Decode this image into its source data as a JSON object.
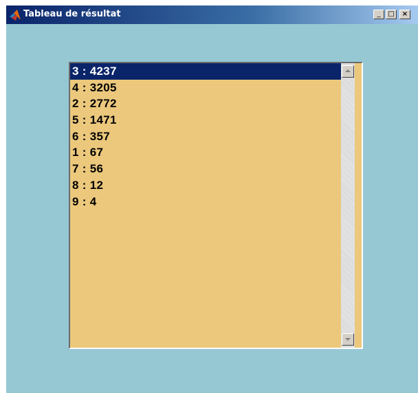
{
  "window": {
    "title": "Tableau de résultat",
    "controls": {
      "minimize": "_",
      "maximize": "□",
      "close": "×"
    },
    "icon": "matlab-icon"
  },
  "list": {
    "selected_index": 0,
    "items": [
      "3 : 4237",
      "4 : 3205",
      "2 : 2772",
      "5 : 1471",
      "6 : 357",
      "1 : 67",
      "7 : 56",
      "8 : 12",
      "9 : 4"
    ]
  },
  "colors": {
    "background": "#96c8d4",
    "list_background": "#ebc87c",
    "selection": "#0a246a",
    "titlebar_start": "#0a246a",
    "titlebar_end": "#a6caf0"
  }
}
